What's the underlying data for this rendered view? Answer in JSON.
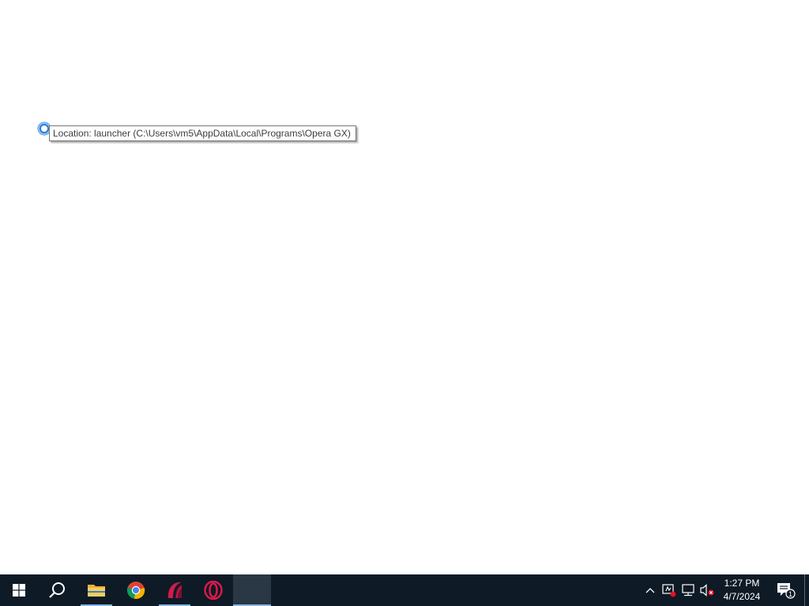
{
  "tooltip": {
    "text": "Location: launcher (C:\\Users\\vm5\\AppData\\Local\\Programs\\Opera GX)"
  },
  "cursor": {
    "icon": "busy-cursor-icon"
  },
  "taskbar": {
    "items": [
      {
        "name": "start-button",
        "icon": "windows-logo-icon"
      },
      {
        "name": "search-button",
        "icon": "search-icon"
      },
      {
        "name": "file-explorer",
        "icon": "folder-icon"
      },
      {
        "name": "chrome",
        "icon": "chrome-icon"
      },
      {
        "name": "opera-gx",
        "icon": "opera-gx-icon"
      },
      {
        "name": "opera",
        "icon": "opera-icon"
      },
      {
        "name": "blank-app",
        "icon": "blank-app-icon"
      }
    ],
    "tray": {
      "icons": [
        "chevron-up-icon",
        "network-error-icon",
        "ethernet-icon",
        "speaker-muted-icon"
      ],
      "time": "1:27 PM",
      "date": "4/7/2024",
      "notification_count": "1"
    },
    "colors": {
      "background": "#0e1a26",
      "accent": "#86b4e0"
    }
  }
}
